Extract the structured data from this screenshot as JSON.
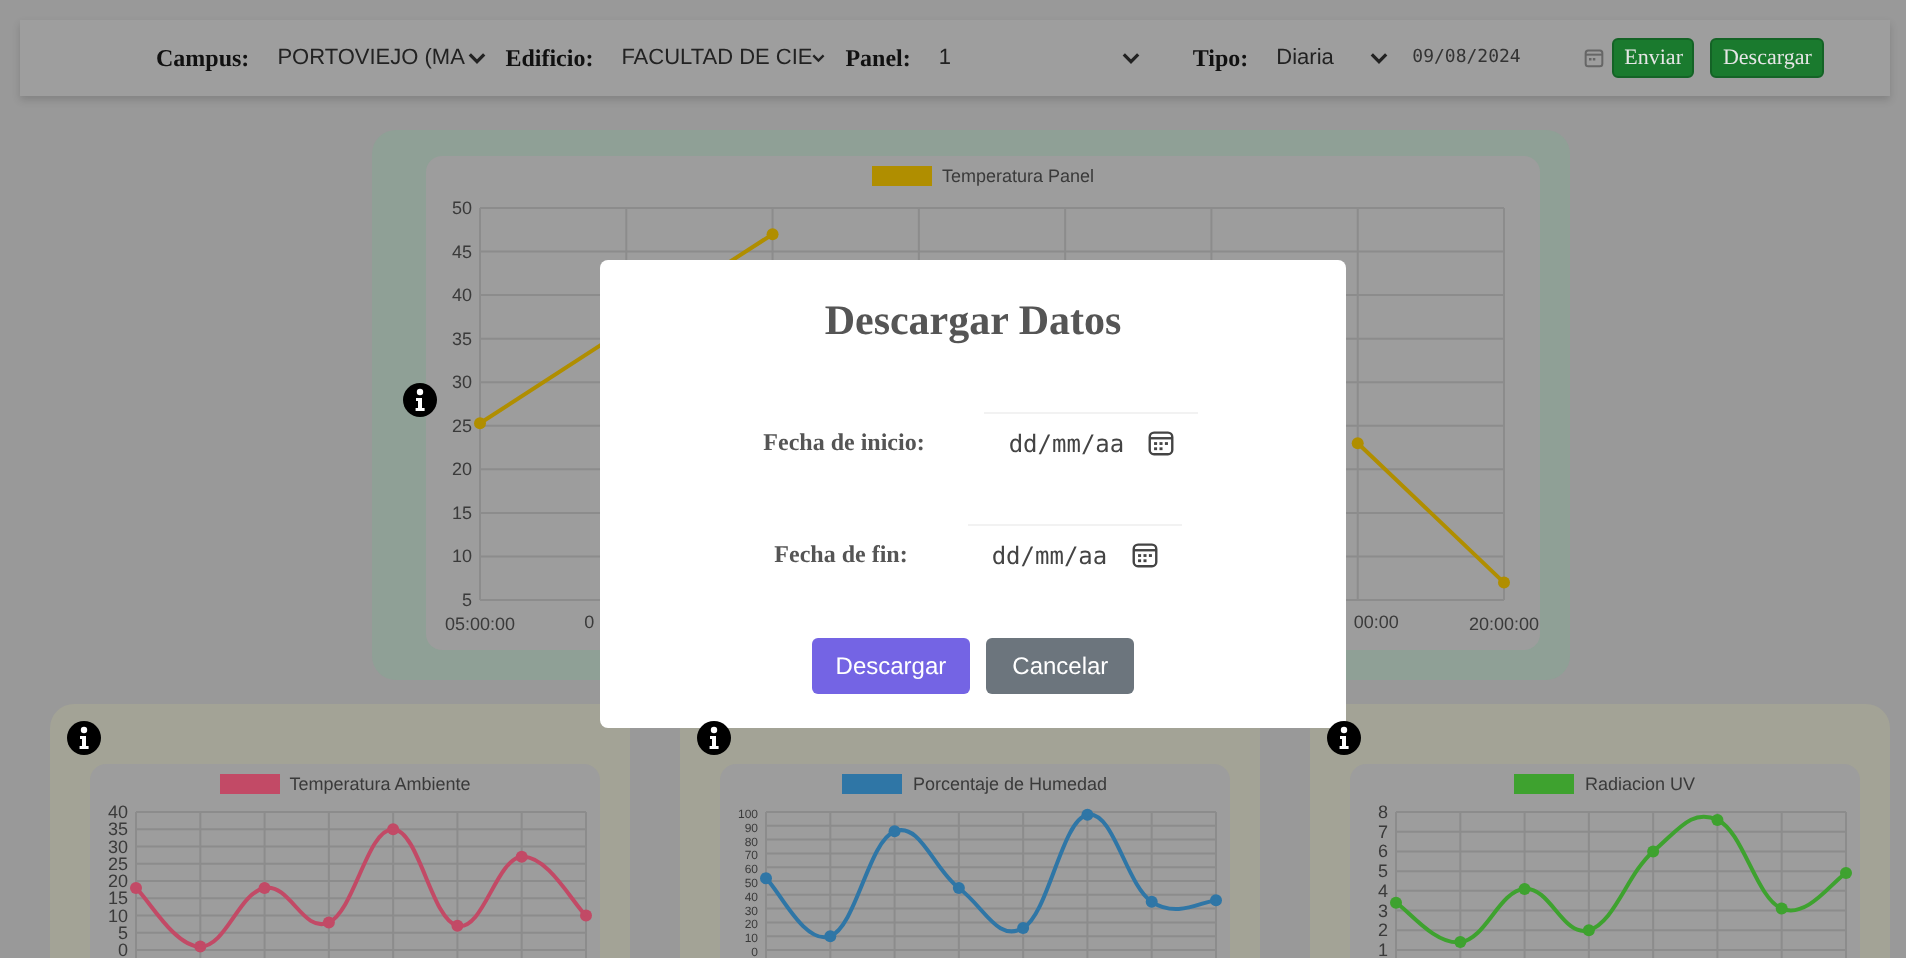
{
  "toolbar": {
    "fields": [
      {
        "label": "Campus:",
        "value": "PORTOVIEJO (MA"
      },
      {
        "label": "Edificio:",
        "value": "FACULTAD DE CIE"
      },
      {
        "label": "Panel:",
        "value": "1"
      },
      {
        "label": "Tipo:",
        "value": "Diaria"
      }
    ],
    "date": "09/08/2024",
    "buttons": [
      "Enviar",
      "Descargar"
    ]
  },
  "charts": [
    {
      "chart_data": {
        "type": "line",
        "grid": true,
        "categories": [
          "05:00:00",
          null,
          null,
          null,
          null,
          null,
          null,
          "20:00:00"
        ],
        "series": [
          {
            "name": "Temperatura Panel",
            "color": "#b08e00",
            "marker": true,
            "values": [
              25.3,
              null,
              47,
              null,
              null,
              null,
              23,
              7
            ]
          }
        ],
        "ylim": [
          5,
          50
        ],
        "yticks": [
          5,
          10,
          15,
          20,
          25,
          30,
          35,
          40,
          45,
          50
        ]
      },
      "cut_labels": [
        "0",
        "00:00"
      ]
    },
    {
      "chart_data": {
        "type": "line",
        "grid": true,
        "series": [
          {
            "name": "Temperatura Ambiente",
            "color": "#c24a66",
            "marker": true,
            "values": [
              18,
              1,
              18,
              8,
              35,
              7,
              27,
              10
            ]
          }
        ],
        "ylim": [
          0,
          40
        ],
        "yticks": [
          0,
          5,
          10,
          15,
          20,
          25,
          30,
          35,
          40
        ]
      }
    },
    {
      "chart_data": {
        "type": "line",
        "grid": true,
        "series": [
          {
            "name": "Porcentaje de Humedad",
            "color": "#2f76a6",
            "marker": true,
            "values": [
              52,
              10,
              86,
              45,
              16,
              98,
              35,
              36
            ]
          }
        ],
        "ylim": [
          0,
          100
        ],
        "yticks": [
          0,
          10,
          20,
          30,
          40,
          50,
          60,
          70,
          80,
          90,
          100
        ]
      }
    },
    {
      "chart_data": {
        "type": "line",
        "grid": true,
        "series": [
          {
            "name": "Radiacion UV",
            "color": "#3ea22f",
            "marker": true,
            "values": [
              3.4,
              1.4,
              4.1,
              2.0,
              6.0,
              7.6,
              3.1,
              4.9
            ]
          }
        ],
        "ylim": [
          1,
          8
        ],
        "yticks": [
          1,
          2,
          3,
          4,
          5,
          6,
          7,
          8
        ]
      }
    }
  ],
  "modal": {
    "title": "Descargar Datos",
    "fields": [
      {
        "label": "Fecha de inicio:",
        "placeholder": "dd/mm/aa"
      },
      {
        "label": "Fecha de fin:",
        "placeholder": "dd/mm/aa"
      }
    ],
    "buttons": [
      {
        "label": "Descargar",
        "kind": "primary"
      },
      {
        "label": "Cancelar",
        "kind": "secondary"
      }
    ]
  }
}
